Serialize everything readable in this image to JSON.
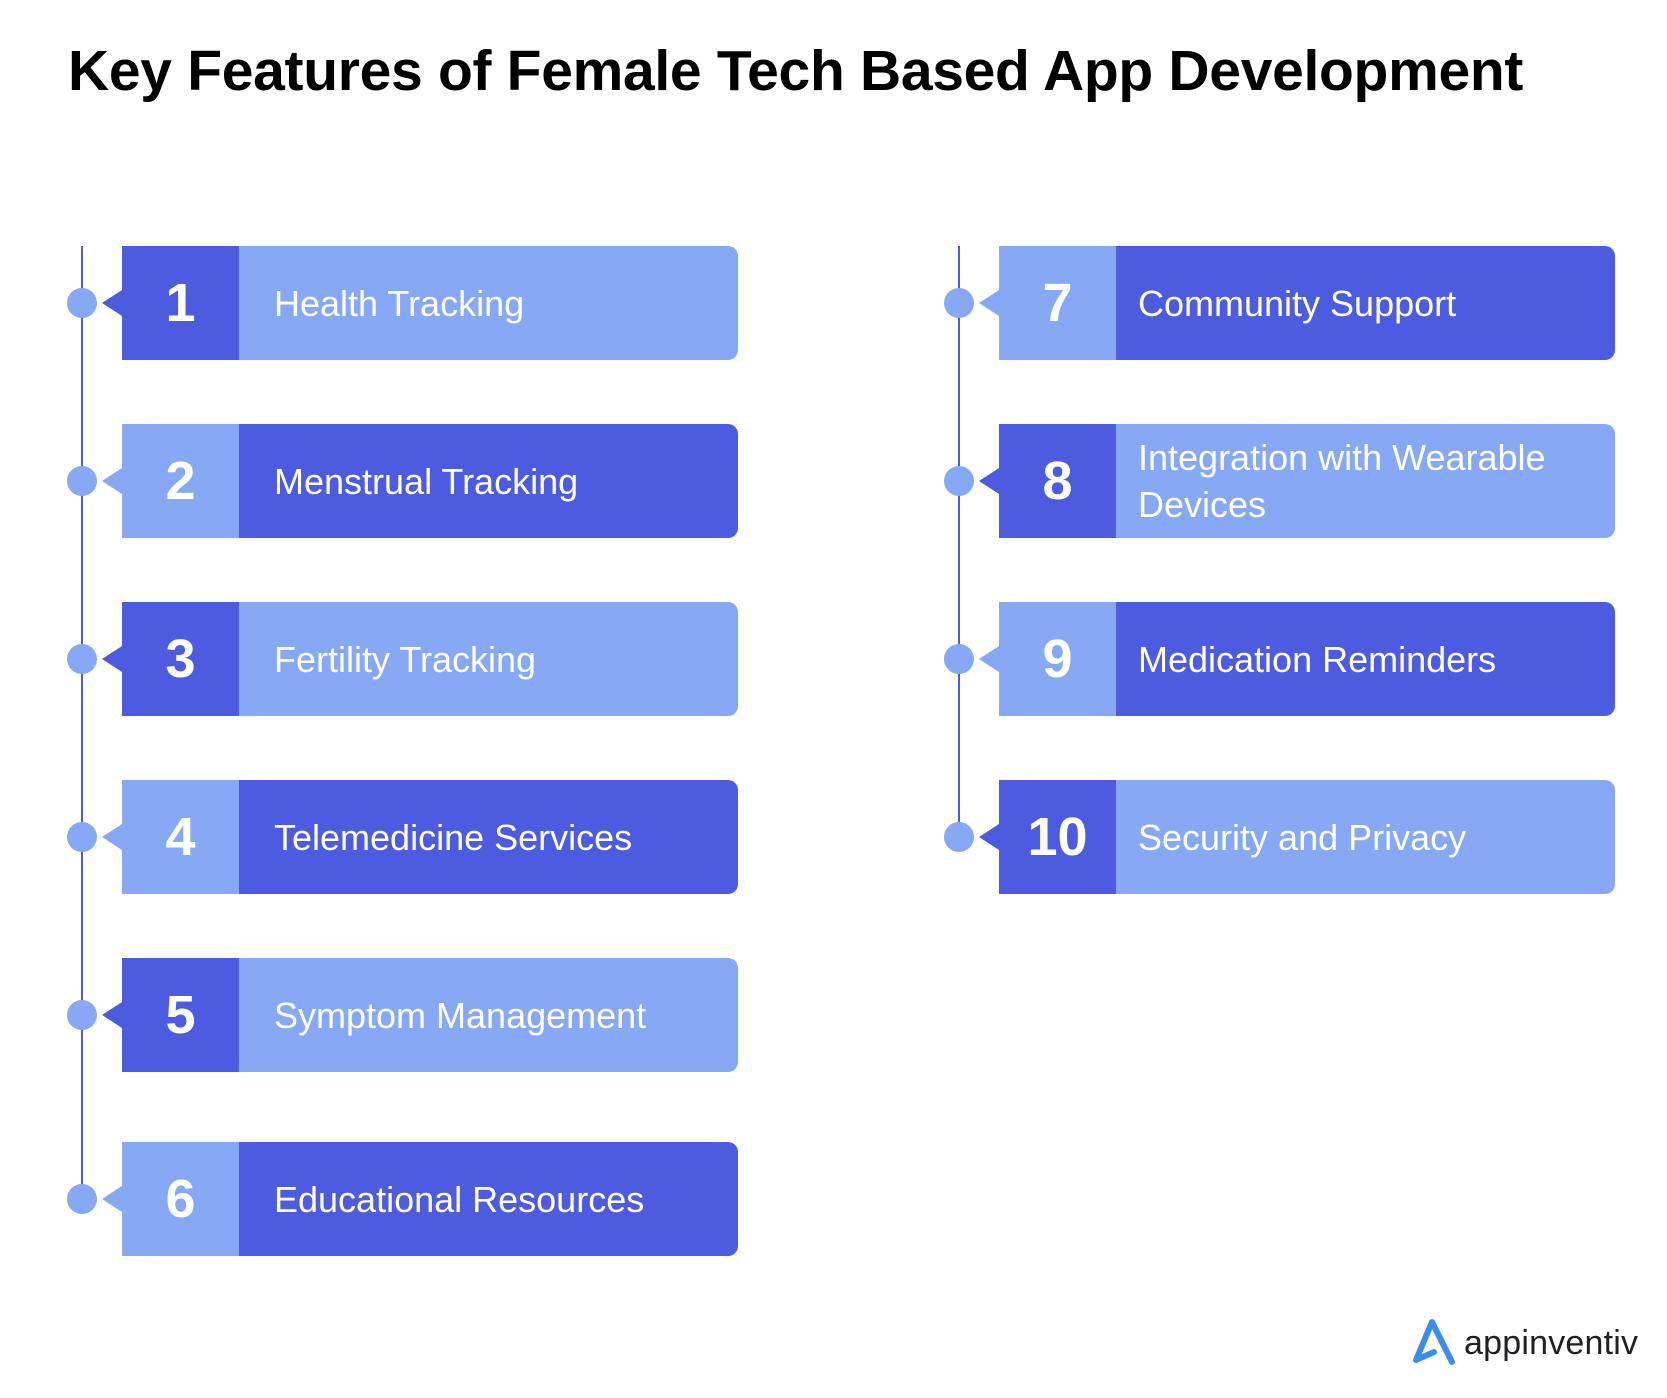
{
  "title": "Key Features of Female Tech Based App Development",
  "colors": {
    "dark": "#4D5BE0",
    "light": "#86A8F5",
    "logo_blue": "#3C8DEB"
  },
  "features": [
    {
      "number": "1",
      "label": "Health Tracking",
      "number_style": "dark",
      "label_style": "light"
    },
    {
      "number": "2",
      "label": "Menstrual Tracking",
      "number_style": "light",
      "label_style": "dark"
    },
    {
      "number": "3",
      "label": "Fertility Tracking",
      "number_style": "dark",
      "label_style": "light"
    },
    {
      "number": "4",
      "label": "Telemedicine Services",
      "number_style": "light",
      "label_style": "dark"
    },
    {
      "number": "5",
      "label": "Symptom Management",
      "number_style": "dark",
      "label_style": "light"
    },
    {
      "number": "6",
      "label": "Educational Resources",
      "number_style": "light",
      "label_style": "dark"
    },
    {
      "number": "7",
      "label": "Community Support",
      "number_style": "light",
      "label_style": "dark"
    },
    {
      "number": "8",
      "label": "Integration with Wearable Devices",
      "number_style": "dark",
      "label_style": "light"
    },
    {
      "number": "9",
      "label": "Medication Reminders",
      "number_style": "light",
      "label_style": "dark"
    },
    {
      "number": "10",
      "label": "Security and Privacy",
      "number_style": "dark",
      "label_style": "light"
    }
  ],
  "logo": {
    "icon": "appinventiv-a-logo-icon",
    "text": "appinventiv"
  }
}
